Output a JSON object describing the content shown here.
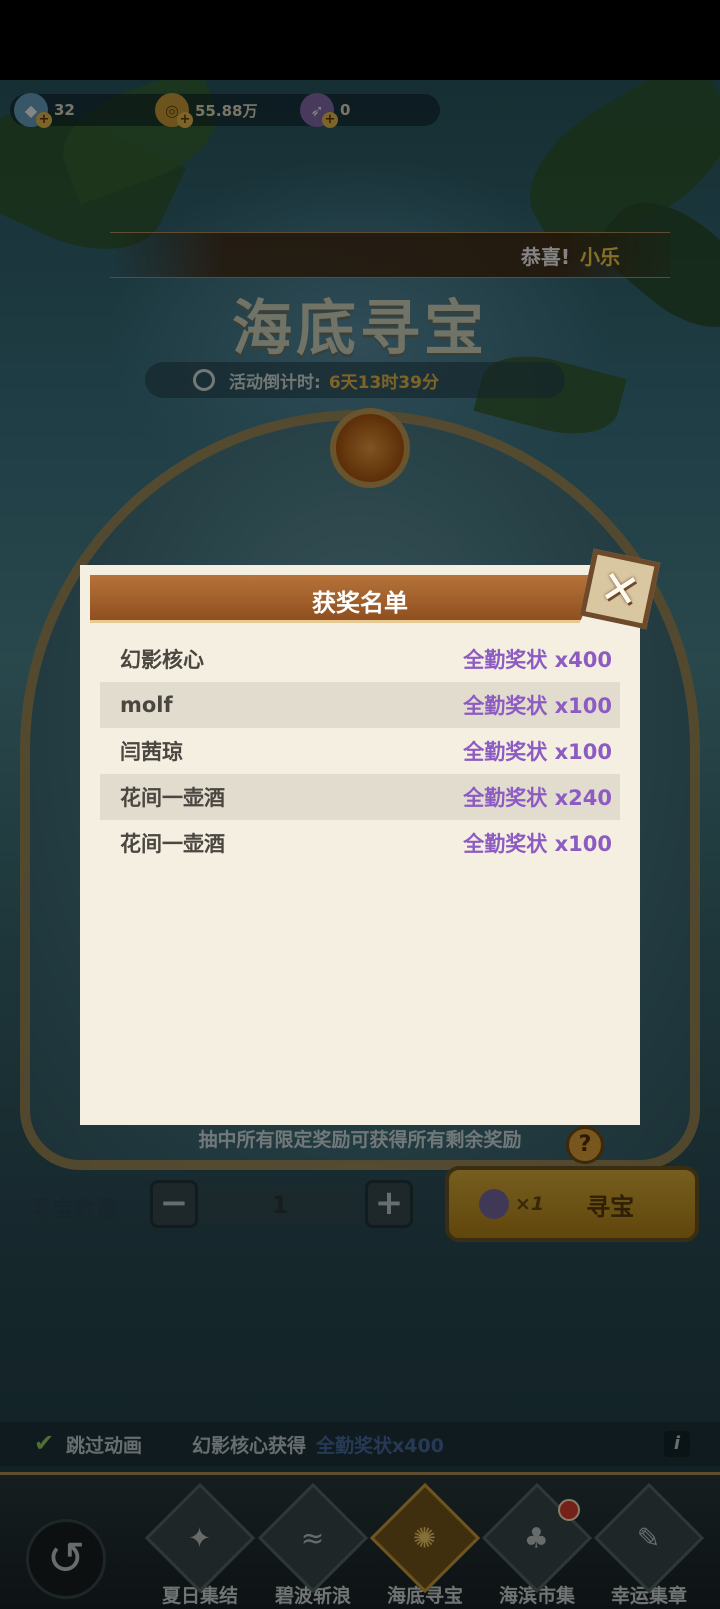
{
  "resources": [
    {
      "icon": "diamond-icon",
      "value": "32"
    },
    {
      "icon": "coin-icon",
      "value": "55.88万"
    },
    {
      "icon": "dart-ticket-icon",
      "value": "0"
    }
  ],
  "notice": {
    "prefix": "恭喜!",
    "name": "小乐"
  },
  "activity": {
    "title": "海底寻宝",
    "countdown_label": "活动倒计时:",
    "countdown_value": "6天13时39分"
  },
  "limit_note": "抽中所有限定奖励可获得所有剩余奖励",
  "controls": {
    "quantity_label": "寻宝数量",
    "minus": "−",
    "quantity": "1",
    "plus": "+",
    "cost": "×1",
    "seek_label": "寻宝"
  },
  "skip": {
    "label": "跳过动画",
    "winner_text": "幻影核心获得",
    "winner_item": "全勤奖状x400"
  },
  "nav": {
    "back_icon": "back-arrow-icon",
    "items": [
      {
        "label": "夏日集结",
        "icon": "fox-emblem-icon"
      },
      {
        "label": "碧波斩浪",
        "icon": "wave-emblem-icon"
      },
      {
        "label": "海底寻宝",
        "icon": "compass-emblem-icon",
        "active": true
      },
      {
        "label": "海滨市集",
        "icon": "palm-emblem-icon",
        "badge": true
      },
      {
        "label": "幸运集章",
        "icon": "stamp-emblem-icon"
      }
    ]
  },
  "dialog": {
    "title": "获奖名单",
    "close_icon": "close-icon",
    "rows": [
      {
        "name": "幻影核心",
        "prize": "全勤奖状 x400"
      },
      {
        "name": "molf",
        "prize": "全勤奖状 x100"
      },
      {
        "name": "闫茜琼",
        "prize": "全勤奖状 x100"
      },
      {
        "name": "花间一壶酒",
        "prize": "全勤奖状 x240"
      },
      {
        "name": "花间一壶酒",
        "prize": "全勤奖状 x100"
      }
    ]
  },
  "colors": {
    "prize_text": "#8d5cc2",
    "header_brown": "#a3622e",
    "panel_bg": "#f5efe2",
    "highlight_yellow": "#ffd64a"
  }
}
